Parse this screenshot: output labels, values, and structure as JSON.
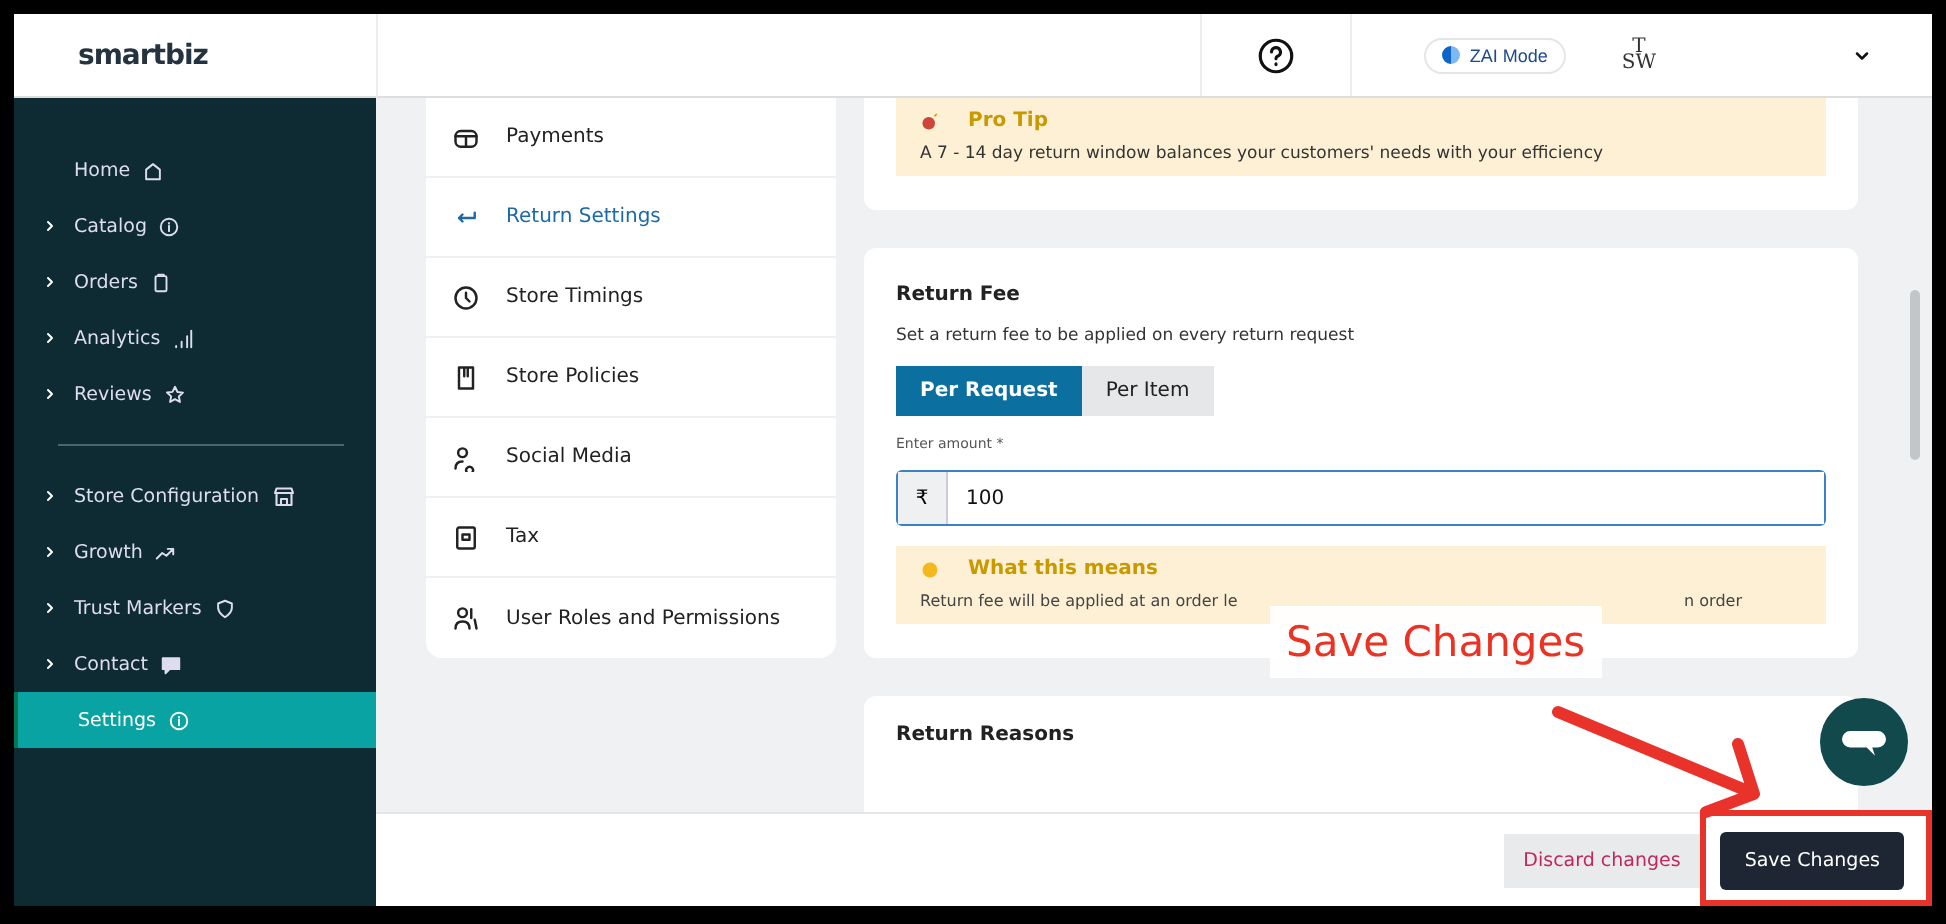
{
  "header": {
    "logo": "smartbiz",
    "mode_toggle": "ZAI Mode",
    "store_logo_top": "T",
    "store_logo_bottom": "SW"
  },
  "sidebar": {
    "items": [
      {
        "label": "Home",
        "has_children": false,
        "selected": false
      },
      {
        "label": "Catalog",
        "has_children": true,
        "selected": false
      },
      {
        "label": "Orders",
        "has_children": true,
        "selected": false
      },
      {
        "label": "Analytics",
        "has_children": true,
        "selected": false
      },
      {
        "label": "Reviews",
        "has_children": true,
        "selected": false
      },
      {
        "label": "Store Configuration",
        "has_children": true,
        "selected": false
      },
      {
        "label": "Growth",
        "has_children": true,
        "selected": false
      },
      {
        "label": "Trust Markers",
        "has_children": true,
        "selected": false
      },
      {
        "label": "Contact",
        "has_children": true,
        "selected": false
      },
      {
        "label": "Settings",
        "has_children": false,
        "selected": true
      }
    ]
  },
  "settings_menu": {
    "items": [
      {
        "label": "Payments",
        "selected": false
      },
      {
        "label": "Return Settings",
        "selected": true
      },
      {
        "label": "Store Timings",
        "selected": false
      },
      {
        "label": "Store Policies",
        "selected": false
      },
      {
        "label": "Social Media",
        "selected": false
      },
      {
        "label": "Tax",
        "selected": false
      },
      {
        "label": "User Roles and Permissions",
        "selected": false
      }
    ]
  },
  "pro_tip": {
    "title": "Pro Tip",
    "text": "A 7 - 14 day return window balances your customers' needs with your efficiency"
  },
  "return_fee": {
    "title": "Return Fee",
    "description": "Set a return fee to be applied on every return request",
    "options": [
      {
        "label": "Per Request",
        "selected": true
      },
      {
        "label": "Per Item",
        "selected": false
      }
    ],
    "amount_label": "Enter amount *",
    "currency": "₹",
    "amount": "100",
    "info": {
      "title": "What this means",
      "text_start": "Return fee will be applied at an order le",
      "text_end": "n order"
    }
  },
  "return_reasons": {
    "title": "Return Reasons"
  },
  "footer": {
    "discard": "Discard changes",
    "save": "Save Changes"
  },
  "annotation": {
    "label": "Save Changes"
  }
}
